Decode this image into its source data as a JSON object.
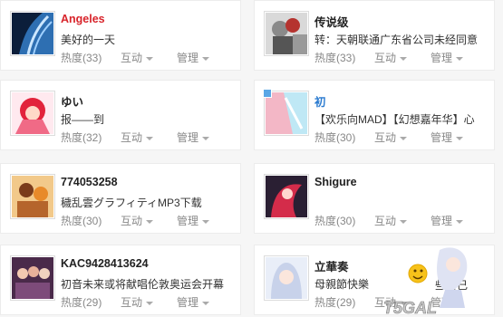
{
  "labels": {
    "activity": "互动",
    "manage": "管理"
  },
  "cards": [
    {
      "name": "Angeles",
      "desc": "美好的一天",
      "heat": "热度(33)",
      "name_color": "#d8232a"
    },
    {
      "name": "传说级",
      "desc": "转：天朝联通广东省公司未经同意",
      "heat": "热度(33)",
      "name_color": "#222222"
    },
    {
      "name": "ゆい",
      "desc": "报——到",
      "heat": "热度(32)",
      "name_color": "#222222"
    },
    {
      "name": "初",
      "desc": "【欢乐向MAD】【幻想嘉年华】心",
      "heat": "热度(30)",
      "name_color": "#2b7bd0"
    },
    {
      "name": "774053258",
      "desc": "穢乱雲グラフィティMP3下载",
      "heat": "热度(30)",
      "name_color": "#222222"
    },
    {
      "name": "Shigure",
      "desc": "",
      "heat": "热度(30)",
      "name_color": "#222222"
    },
    {
      "name": "KAC9428413624",
      "desc": "初音未来或将献唱伦敦奥运会开幕",
      "heat": "热度(29)",
      "name_color": "#222222"
    },
    {
      "name": "立華奏",
      "desc": "母親節快樂",
      "heat": "热度(29)",
      "name_color": "#222222"
    }
  ],
  "overlay_text": "些自己",
  "watermark": "T5GAL"
}
